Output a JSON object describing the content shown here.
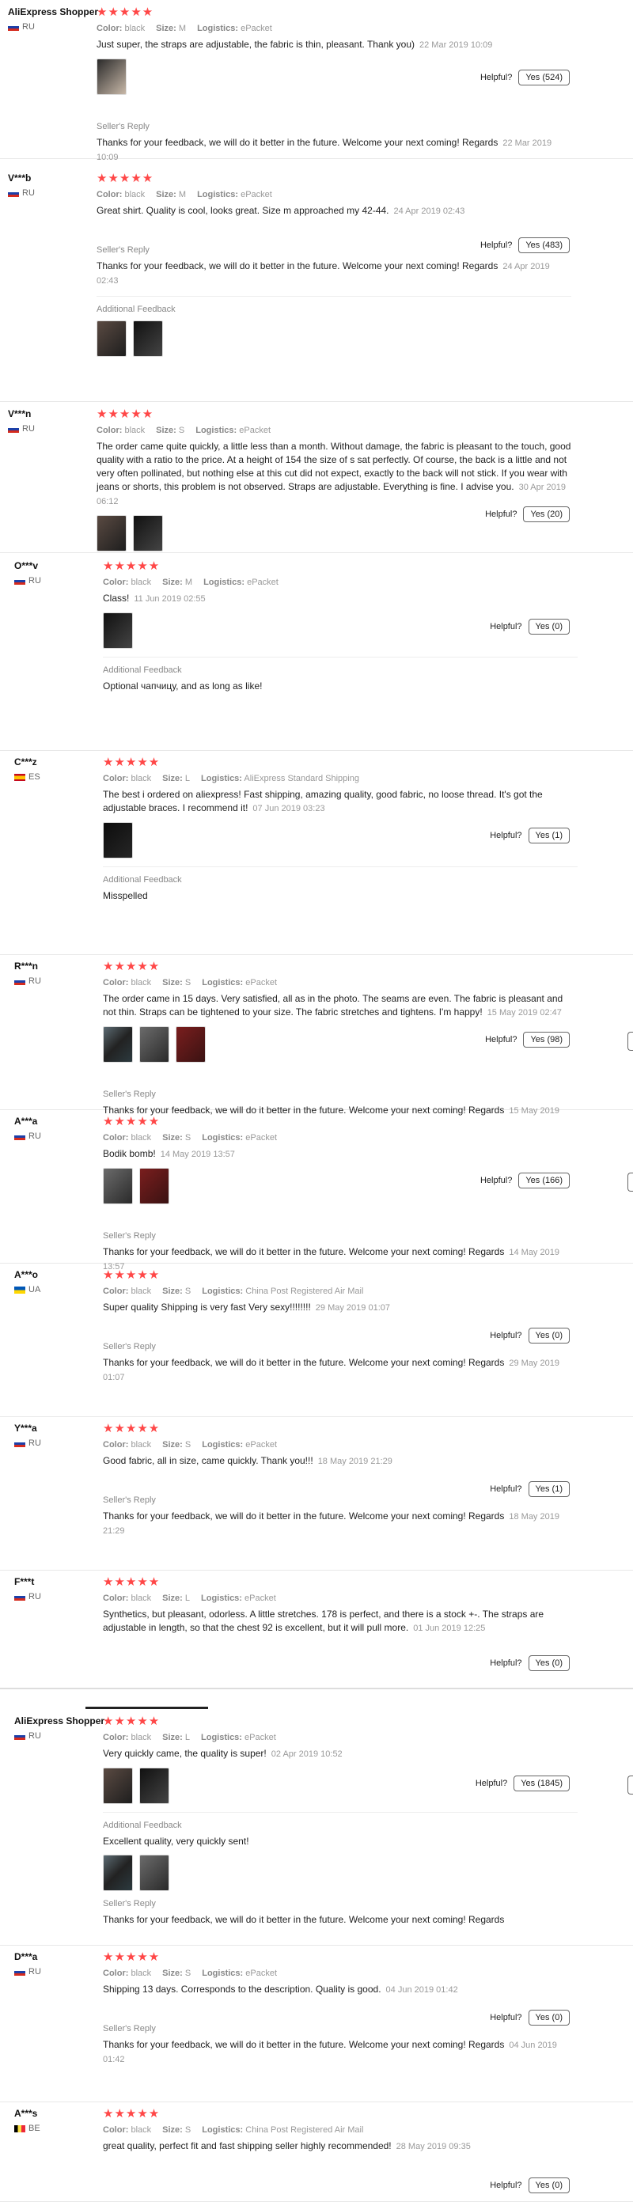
{
  "labels": {
    "color": "Color:",
    "size": "Size:",
    "logistics": "Logistics:",
    "helpful": "Helpful?",
    "seller_reply": "Seller's Reply",
    "additional_feedback": "Additional Feedback"
  },
  "reviews": [
    {
      "user": "AliExpress Shopper",
      "country": "RU",
      "color": "black",
      "size": "M",
      "logistics": "ePacket",
      "text": "Just super, the straps are adjustable, the fabric is thin, pleasant. Thank you)",
      "date": "22 Mar 2019 10:09",
      "helpful_yes": "Yes (524)",
      "seller_reply": "Thanks for your feedback, we will do it better in the future. Welcome your next coming! Regards",
      "reply_date": "22 Mar 2019 10:09"
    },
    {
      "user": "V***b",
      "country": "RU",
      "color": "black",
      "size": "M",
      "logistics": "ePacket",
      "text": "Great shirt. Quality is cool, looks great. Size m approached my 42-44.",
      "date": "24 Apr 2019 02:43",
      "helpful_yes": "Yes (483)",
      "seller_reply": "Thanks for your feedback, we will do it better in the future. Welcome your next coming! Regards",
      "reply_date": "24 Apr 2019 02:43"
    },
    {
      "user": "V***n",
      "country": "RU",
      "color": "black",
      "size": "S",
      "logistics": "ePacket",
      "text": "The order came quite quickly, a little less than a month. Without damage, the fabric is pleasant to the touch, good quality with a ratio to the price. At a height of 154 the size of s sat perfectly. Of course, the back is a little and not very often pollinated, but nothing else at this cut did not expect, exactly to the back will not stick. If you wear with jeans or shorts, this problem is not observed. Straps are adjustable. Everything is fine. I advise you.",
      "date": "30 Apr 2019 06:12",
      "helpful_yes": "Yes (20)"
    },
    {
      "user": "O***v",
      "country": "RU",
      "color": "black",
      "size": "M",
      "logistics": "ePacket",
      "text": "Class!",
      "date": "11 Jun 2019 02:55",
      "helpful_yes": "Yes (0)",
      "additional_feedback": "Optional чапчицу, and as long as like!"
    },
    {
      "user": "C***z",
      "country": "ES",
      "color": "black",
      "size": "L",
      "logistics": "AliExpress Standard Shipping",
      "text": "The best i ordered on aliexpress! Fast shipping, amazing quality, good fabric, no loose thread. It's got the adjustable braces. I recommend it!",
      "date": "07 Jun 2019 03:23",
      "helpful_yes": "Yes (1)",
      "additional_feedback": "Misspelled"
    },
    {
      "user": "R***n",
      "country": "RU",
      "color": "black",
      "size": "S",
      "logistics": "ePacket",
      "text": "The order came in 15 days. Very satisfied, all as in the photo. The seams are even. The fabric is pleasant and not thin. Straps can be tightened to your size. The fabric stretches and tightens. I'm happy!",
      "date": "15 May 2019 02:47",
      "helpful_yes": "Yes (98)",
      "seller_reply": "Thanks for your feedback, we will do it better in the future. Welcome your next coming! Regards",
      "reply_date": "15 May 2019"
    },
    {
      "user": "A***a",
      "country": "RU",
      "color": "black",
      "size": "S",
      "logistics": "ePacket",
      "text": "Bodik bomb!",
      "date": "14 May 2019 13:57",
      "helpful_yes": "Yes (166)",
      "seller_reply": "Thanks for your feedback, we will do it better in the future. Welcome your next coming! Regards",
      "reply_date": "14 May 2019 13:57"
    },
    {
      "user": "A***o",
      "country": "UA",
      "color": "black",
      "size": "S",
      "logistics": "China Post Registered Air Mail",
      "text": "Super quality Shipping is very fast Very sexy!!!!!!!!",
      "date": "29 May 2019 01:07",
      "helpful_yes": "Yes (0)",
      "seller_reply": "Thanks for your feedback, we will do it better in the future. Welcome your next coming! Regards",
      "reply_date": "29 May 2019 01:07"
    },
    {
      "user": "Y***a",
      "country": "RU",
      "color": "black",
      "size": "S",
      "logistics": "ePacket",
      "text": "Good fabric, all in size, came quickly. Thank you!!!",
      "date": "18 May 2019 21:29",
      "helpful_yes": "Yes (1)",
      "seller_reply": "Thanks for your feedback, we will do it better in the future. Welcome your next coming! Regards",
      "reply_date": "18 May 2019 21:29"
    },
    {
      "user": "F***t",
      "country": "RU",
      "color": "black",
      "size": "L",
      "logistics": "ePacket",
      "text": "Synthetics, but pleasant, odorless. A little stretches. 178 is perfect, and there is a stock +-. The straps are adjustable in length, so that the chest 92 is excellent, but it will pull more.",
      "date": "01 Jun 2019 12:25",
      "helpful_yes": "Yes (0)"
    },
    {
      "user": "AliExpress Shopper",
      "country": "RU",
      "color": "black",
      "size": "L",
      "logistics": "ePacket",
      "text": "Very quickly came, the quality is super!",
      "date": "02 Apr 2019 10:52",
      "helpful_yes": "Yes (1845)",
      "additional_feedback": "Excellent quality, very quickly sent!",
      "seller_reply": "Thanks for your feedback, we will do it better in the future. Welcome your next coming! Regards"
    },
    {
      "user": "D***a",
      "country": "RU",
      "color": "black",
      "size": "S",
      "logistics": "ePacket",
      "text": "Shipping 13 days. Corresponds to the description. Quality is good.",
      "date": "04 Jun 2019 01:42",
      "helpful_yes": "Yes (0)",
      "seller_reply": "Thanks for your feedback, we will do it better in the future. Welcome your next coming! Regards",
      "reply_date": "04 Jun 2019 01:42"
    },
    {
      "user": "A***s",
      "country": "BE",
      "color": "black",
      "size": "S",
      "logistics": "China Post Registered Air Mail",
      "text": "great quality, perfect fit and fast shipping seller highly recommended!",
      "date": "28 May 2019 09:35",
      "helpful_yes": "Yes (0)"
    }
  ],
  "stars": "★★★★★",
  "colors": {
    "star": "#ff4747",
    "muted": "#999999",
    "text": "#222222"
  }
}
